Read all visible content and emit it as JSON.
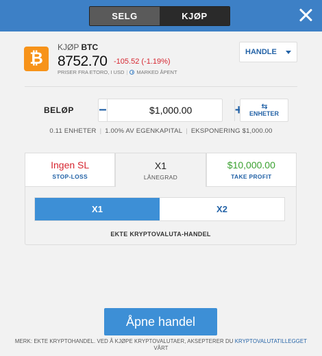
{
  "header": {
    "sell_label": "SELG",
    "buy_label": "KJØP"
  },
  "instrument": {
    "action": "KJØP",
    "symbol": "BTC",
    "logo_glyph": "₿",
    "price": "8752.70",
    "change": "-105.52 (-1.19%)",
    "price_source": "PRISER FRA ETORO, I USD",
    "market_status": "MARKED ÅPENT"
  },
  "trade_type": {
    "selected": "HANDLE"
  },
  "amount": {
    "label": "BELØP",
    "value": "$1,000.00",
    "minus": "−",
    "plus": "+",
    "units_label": "ENHETER",
    "units_icon": "⇆"
  },
  "info": {
    "units": "0.11 ENHETER",
    "equity": "1.00% AV EGENKAPITAL",
    "exposure": "EKSPONERING $1,000.00"
  },
  "tabs": {
    "stop_loss": {
      "value": "Ingen SL",
      "label": "STOP-LOSS"
    },
    "leverage": {
      "value": "X1",
      "label": "LÅNEGRAD"
    },
    "take_profit": {
      "value": "$10,000.00",
      "label": "TAKE PROFIT"
    }
  },
  "leverage": {
    "options": [
      "X1",
      "X2"
    ],
    "selected": "X1",
    "footer": "EKTE KRYPTOVALUTA-HANDEL"
  },
  "open_trade": {
    "label": "Åpne handel"
  },
  "note": {
    "text": "MERK: EKTE KRYPTOHANDEL. VED Å KJØPE KRYPTOVALUTAER, AKSEPTERER DU",
    "link": "KRYPTOVALUTATILLEGGET",
    "tail": "VÅRT"
  },
  "colors": {
    "header_bg": "#3d80c6",
    "accent": "#3d8fd6",
    "negative": "#d6252f",
    "positive": "#3aa130",
    "btc": "#f7931a"
  }
}
